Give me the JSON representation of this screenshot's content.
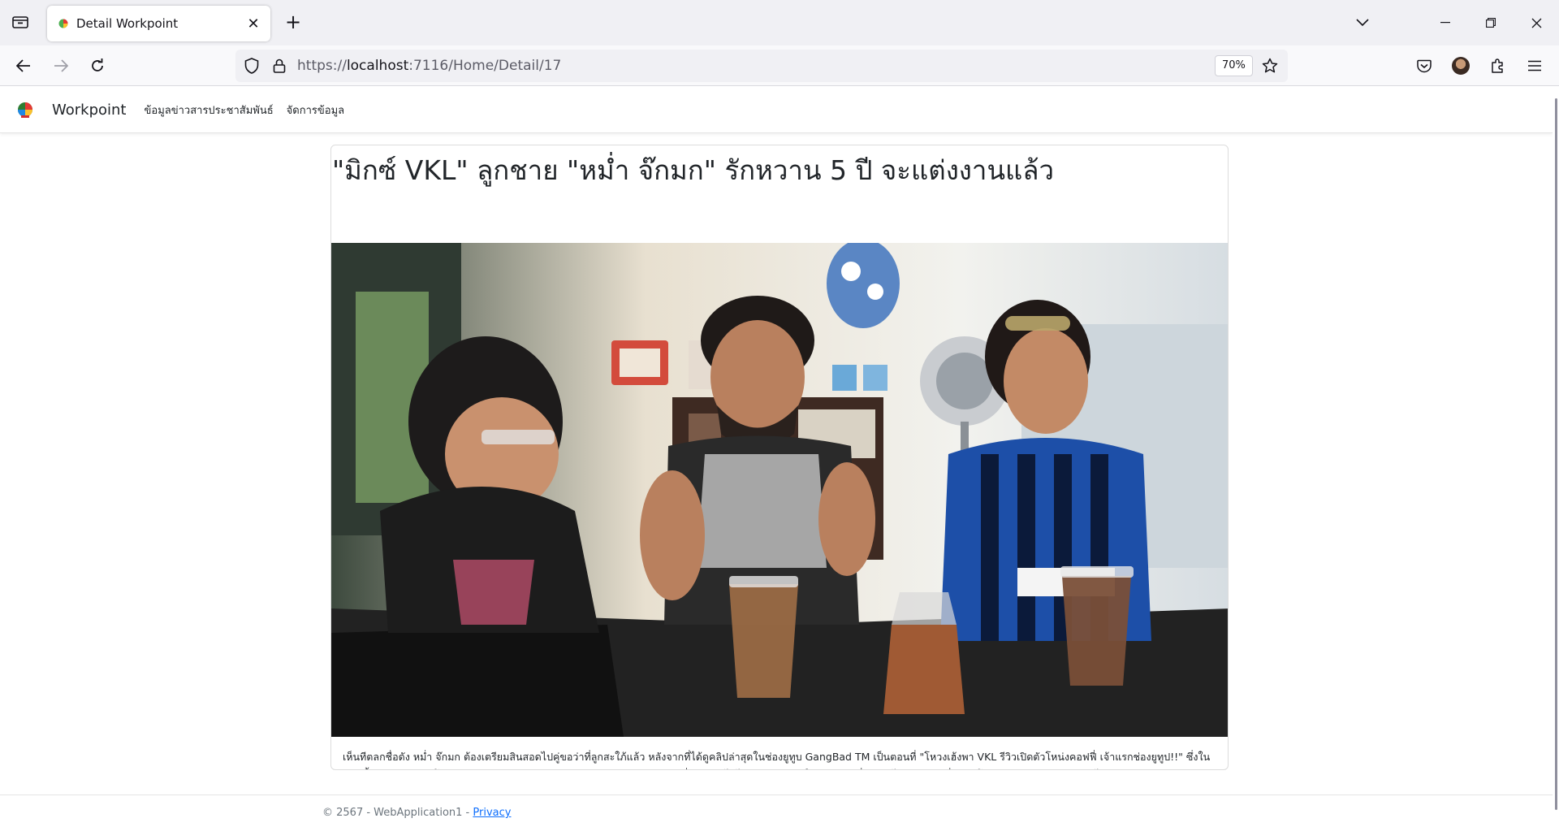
{
  "browser": {
    "tab_title": "Detail Workpoint",
    "url_prefix": "https://",
    "url_host": "localhost",
    "url_rest": ":7116/Home/Detail/17",
    "zoom": "70%"
  },
  "site": {
    "brand": "Workpoint",
    "nav": [
      {
        "label": "ข้อมูลข่าวสารประชาสัมพันธ์"
      },
      {
        "label": "จัดการข้อมูล"
      }
    ]
  },
  "article": {
    "title": "\"มิกซ์ VKL\" ลูกชาย \"หม่ำ จ๊กมก\" รักหวาน 5 ปี จะแต่งงานแล้ว",
    "body": "เห็นทีตลกชื่อดัง หม่ำ จ๊กมก ต้องเตรียมสินสอดไปคู่ขอว่าที่ลูกสะใภ้แล้ว หลังจากที่ได้ดูคลิปล่าสุดในช่องยูทูบ GangBad TM เป็นตอนที่ \"โหวงเฮ้งพา VKL รีวิวเปิดตัวโหน่งคอฟฟี่ เจ้าแรกช่องยูทูป!!\" ซึ่งในคลิปนั้นฮาหนักมาก! โหวงเฮ้ง ลูกชายของ เท่ง เถิดเทิง กับ มิกซ์ VKL ลูกชาย หม่ำ จ๊กมก ได้ไปบุกร้านกาแฟใหม่ของ บุหรี่ แต่คันไปเจอพ่อบุหรี่อย่าง โหน่ง ชะชะช่า ชะก่อน เลยได้อัปเดตชีวิตส่วนตัวกันยกใหญ่ โดยเฉพาะเรื่องความรัก โหน่ง เล่าว่า บุหรี่ ลูกชายเนี่ยรักเดียวใจเดียวมีแฟนคนเดียวมาตั้งแต่เด็ก ส่วน มิกซ์ กับ โหวงเฮ้ง ก็ไม่น้อยหน้า ต่างคนต่างแซวเรื่องแฟนเก่าไหม่กันไปมา จนสุดท้ายทั้งคู่ก็ประกาศข่าวดีว่าจะแต่งงานในปีนี้ด้วยกันทั้งคู่! โหวงเฮ้ง ก็มีลูกชายตัวน้อยน่ารักวัย 1 ขวบแล้ว ส่วน มิกซ์ ก็คบกับแฟนสาวมานานถึง 5 ปี เรียกว่าเป็นข่าวดีจริงๆ"
  },
  "footer": {
    "text": "© 2567 - WebApplication1 - ",
    "privacy": "Privacy"
  },
  "icons": [
    "tab-list-icon",
    "favicon-icon",
    "close-icon",
    "plus-icon",
    "chevron-down-icon",
    "minimize-icon",
    "restore-icon",
    "close-window-icon",
    "back-arrow-icon",
    "forward-arrow-icon",
    "reload-icon",
    "shield-icon",
    "lock-icon",
    "star-icon",
    "pocket-icon",
    "profile-icon",
    "extensions-icon",
    "menu-icon"
  ]
}
